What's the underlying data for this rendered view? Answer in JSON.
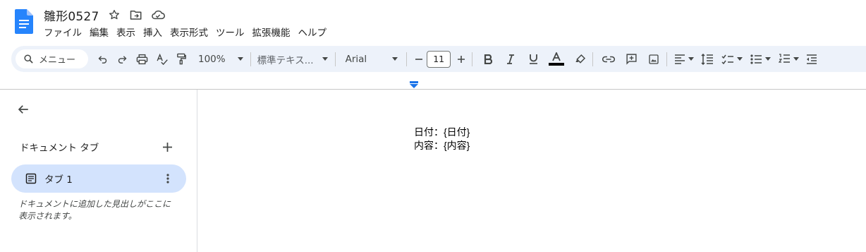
{
  "doc": {
    "title": "雛形0527",
    "menu": [
      "ファイル",
      "編集",
      "表示",
      "挿入",
      "表示形式",
      "ツール",
      "拡張機能",
      "ヘルプ"
    ]
  },
  "toolbar": {
    "search_label": "メニュー",
    "zoom": "100%",
    "style": "標準テキス...",
    "font": "Arial",
    "font_size": "11",
    "text_color_hex": "#000000"
  },
  "sidebar": {
    "heading": "ドキュメント タブ",
    "tabs": [
      {
        "label": "タブ 1"
      }
    ],
    "hint": "ドキュメントに追加した見出しがここに表示されます。"
  },
  "body": {
    "lines": [
      "日付：{日付}",
      "内容：{内容}"
    ]
  },
  "colors": {
    "accent": "#1a73e8",
    "toolbar_bg": "#edf2fa",
    "tab_selected_bg": "#d3e3fd"
  }
}
